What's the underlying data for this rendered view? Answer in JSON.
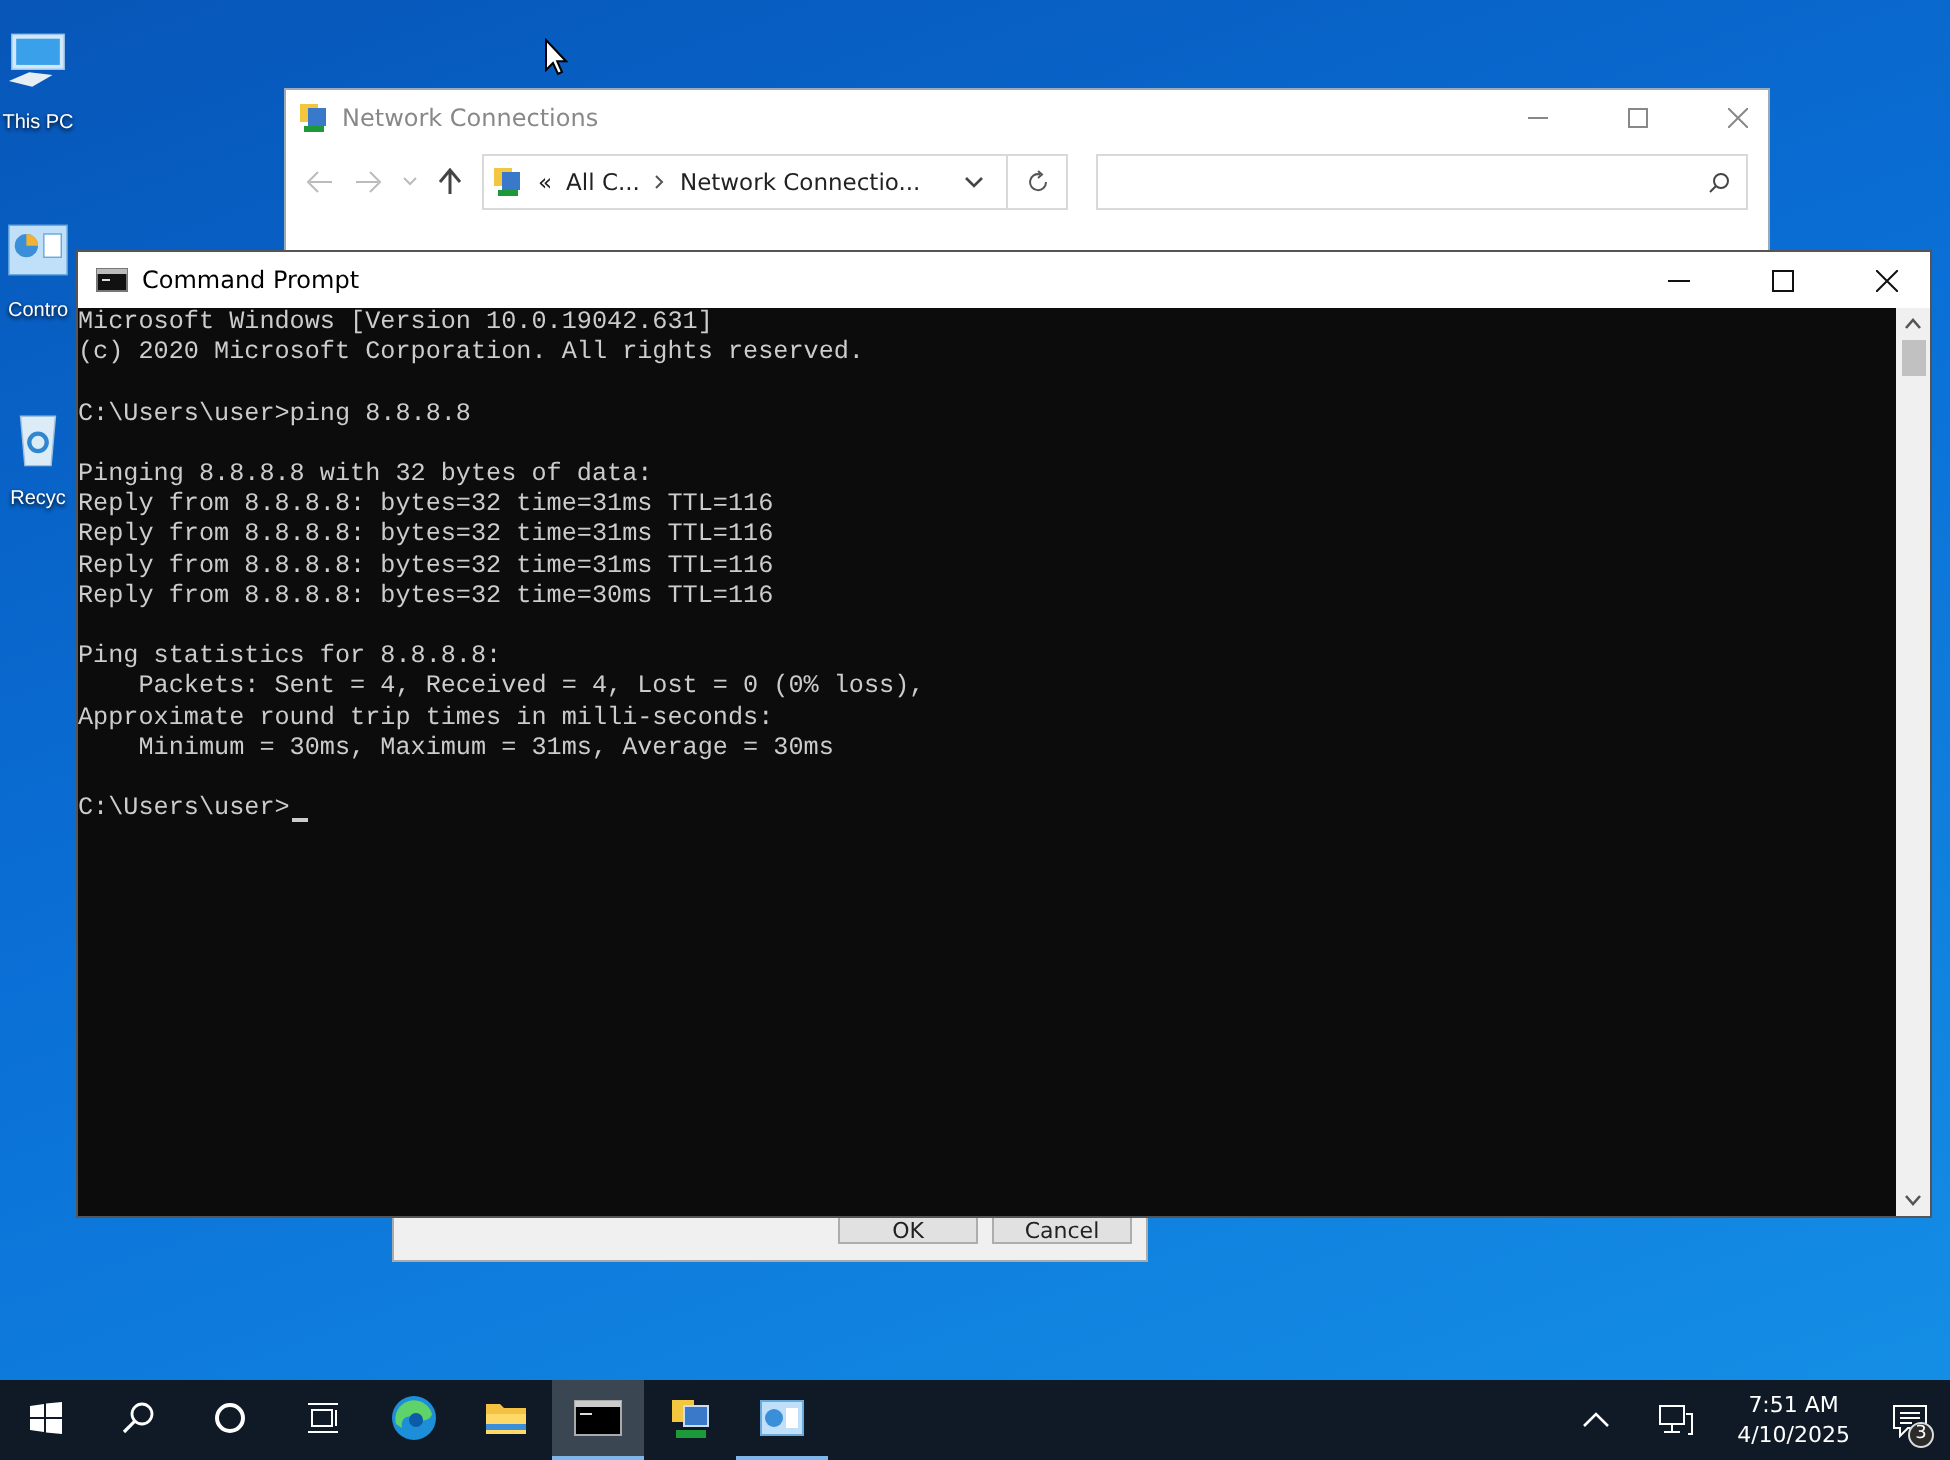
{
  "desktop_icons": [
    {
      "label": "This PC",
      "kind": "pc"
    },
    {
      "label": "Contro",
      "kind": "control"
    },
    {
      "label": "Recyc",
      "kind": "recycle"
    }
  ],
  "explorer": {
    "title": "Network Connections",
    "path_prefix": "«",
    "path": [
      "All C...",
      "Network Connectio..."
    ]
  },
  "dialog": {
    "buttons": [
      "OK",
      "Cancel"
    ]
  },
  "cmd": {
    "title": "Command Prompt",
    "blocks": [
      [
        "Microsoft Windows [Version 10.0.19042.631]",
        "(c) 2020 Microsoft Corporation. All rights reserved."
      ],
      [
        "C:\\Users\\user>ping 8.8.8.8"
      ],
      [
        "Pinging 8.8.8.8 with 32 bytes of data:",
        "Reply from 8.8.8.8: bytes=32 time=31ms TTL=116",
        "Reply from 8.8.8.8: bytes=32 time=31ms TTL=116",
        "Reply from 8.8.8.8: bytes=32 time=31ms TTL=116",
        "Reply from 8.8.8.8: bytes=32 time=30ms TTL=116"
      ],
      [
        "Ping statistics for 8.8.8.8:",
        "    Packets: Sent = 4, Received = 4, Lost = 0 (0% loss),",
        "Approximate round trip times in milli-seconds:",
        "    Minimum = 30ms, Maximum = 31ms, Average = 30ms"
      ],
      [
        "C:\\Users\\user>"
      ]
    ]
  },
  "taskbar": {
    "items": [
      {
        "kind": "start",
        "selected": false,
        "running": false
      },
      {
        "kind": "search",
        "selected": false,
        "running": false
      },
      {
        "kind": "cortana",
        "selected": false,
        "running": false
      },
      {
        "kind": "taskview",
        "selected": false,
        "running": false
      },
      {
        "kind": "edge",
        "selected": false,
        "running": false
      },
      {
        "kind": "files",
        "selected": false,
        "running": false
      },
      {
        "kind": "cmd",
        "selected": true,
        "running": true
      },
      {
        "kind": "network",
        "selected": false,
        "running": false
      },
      {
        "kind": "control",
        "selected": false,
        "running": true
      }
    ],
    "time": "7:51 AM",
    "date": "4/10/2025",
    "notifications": "3"
  }
}
